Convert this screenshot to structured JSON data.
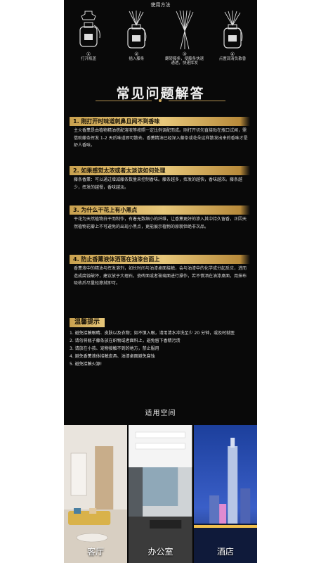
{
  "usage": {
    "title": "使用方法",
    "steps": [
      {
        "num": "①",
        "text": "打开瓶盖"
      },
      {
        "num": "②",
        "text": "插入藤条"
      },
      {
        "num": "③",
        "text": "翻转藤条，使藤条快速通透，快速挥发"
      },
      {
        "num": "④",
        "text": "点置润清负散香"
      }
    ]
  },
  "faq": {
    "heading": "常见问题解答",
    "items": [
      {
        "question": "1. 刚打开时味道刺鼻且闻不到香味",
        "answer": "主火香薰是由植物精油搭配溶液等按照一定比例调配而成。刚打开切勿直接贴在瓶口试闻，需借助藤条挥发 1-2 天后味道即可散去。香薰精油已经深入藤条或花朵这样散发出来的香味才是舒人香味。"
      },
      {
        "question": "2. 如果感觉太浓或者太淡该如何处理",
        "answer": "藤条香薰：可以通过增减藤条数量来控制香味。藤条越多，挥发的越快，香味越浓。藤条越少，挥发的越慢，香味越淡。"
      },
      {
        "question": "3. 为什么干花上有小黑点",
        "answer": "干花为天然植物白干而制作，有着无数细小的纤维，让香薰更好的渗入其中持久留香，正因天然植物花瓣上不可避免的出现小黑点，更能展示植物的原貌但绝非次品。"
      },
      {
        "question": "4. 防止香薰液体洒落在油漆台面上",
        "answer": "香薰液中的精油与挥发溶剂，如长时间与油漆桌面接触，会与油漆中的化学成分起反应，进而造成腐蚀破坏，建议放于大理石，瓷砖面或者玻璃面进行操作，若不慎洒在油漆桌面，用抹布吸收后尽量轻擦拭即可。"
      }
    ]
  },
  "tips": {
    "title": "温馨提示",
    "items": [
      "1. 避免接触眼睛、皮肤以及衣物；如不慎入眼，请用清水冲洗至少 20 分钟，或及时就医",
      "2. 请勿将瓶子藤条放在织物或者面料上，避免留下香精污渍",
      "3. 请放在小孩、宠物接触不到的地方，禁止服用",
      "4. 避免香薰液体接触皮具、油漆桌面避免腐蚀",
      "5. 避免接触火源!"
    ]
  },
  "spaces": {
    "title": "适用空间",
    "rooms": [
      {
        "label": "客厅"
      },
      {
        "label": "办公室"
      },
      {
        "label": "酒店"
      }
    ]
  },
  "colors": {
    "background": "#090909",
    "gold": "#d4ae5f",
    "page": "#ffffff"
  }
}
